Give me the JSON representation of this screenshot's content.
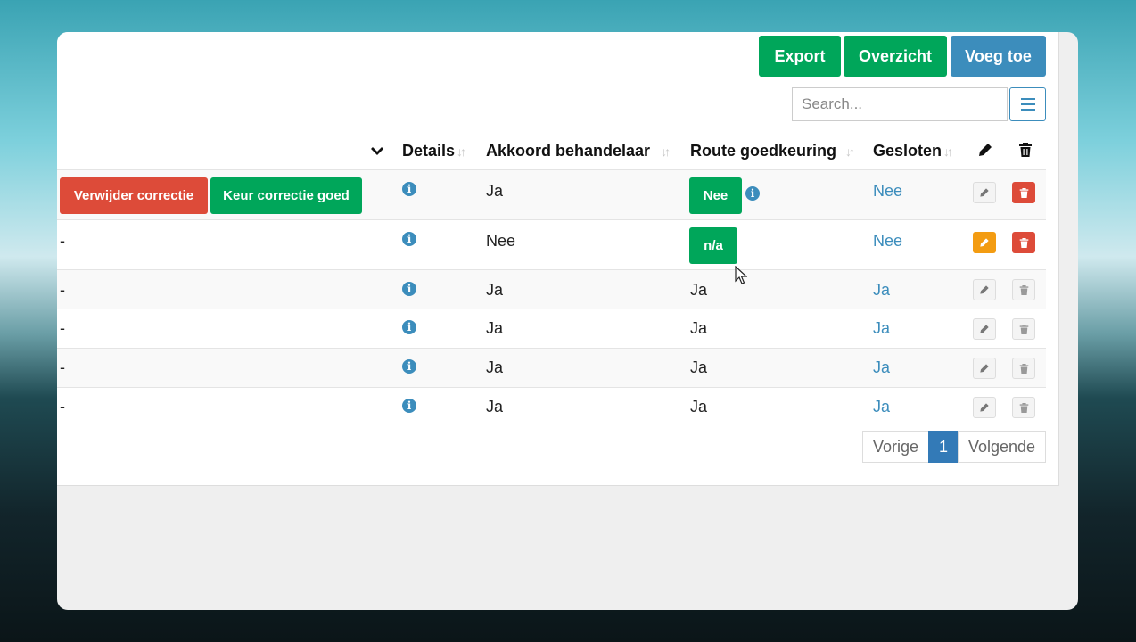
{
  "toolbar": {
    "export_label": "Export",
    "overview_label": "Overzicht",
    "add_label": "Voeg toe"
  },
  "search": {
    "placeholder": "Search...",
    "value": ""
  },
  "table": {
    "headers": {
      "details": "Details",
      "akkoord": "Akkoord behandelaar",
      "route": "Route goedkeuring",
      "gesloten": "Gesloten"
    },
    "rows": [
      {
        "actions": {
          "reject_label": "Verwijder correctie",
          "approve_label": "Keur correctie goed"
        },
        "first": "",
        "akkoord": "Ja",
        "route_button": "Nee",
        "route_text": "",
        "gesloten": "Nee"
      },
      {
        "first": "-",
        "akkoord": "Nee",
        "route_button": "n/a",
        "route_text": "",
        "gesloten": "Nee"
      },
      {
        "first": "-",
        "akkoord": "Ja",
        "route_button": "",
        "route_text": "Ja",
        "gesloten": "Ja"
      },
      {
        "first": "-",
        "akkoord": "Ja",
        "route_button": "",
        "route_text": "Ja",
        "gesloten": "Ja"
      },
      {
        "first": "-",
        "akkoord": "Ja",
        "route_button": "",
        "route_text": "Ja",
        "gesloten": "Ja"
      },
      {
        "first": "-",
        "akkoord": "Ja",
        "route_button": "",
        "route_text": "Ja",
        "gesloten": "Ja"
      }
    ]
  },
  "pagination": {
    "prev_label": "Vorige",
    "current_page": "1",
    "next_label": "Volgende"
  },
  "colors": {
    "green": "#00a65a",
    "blue": "#3c8dbc",
    "red": "#dd4b39",
    "orange": "#f39c12"
  },
  "icons": [
    "chevron-down-icon",
    "sort-icon",
    "pencil-icon",
    "trash-icon",
    "info-icon",
    "menu-icon"
  ]
}
